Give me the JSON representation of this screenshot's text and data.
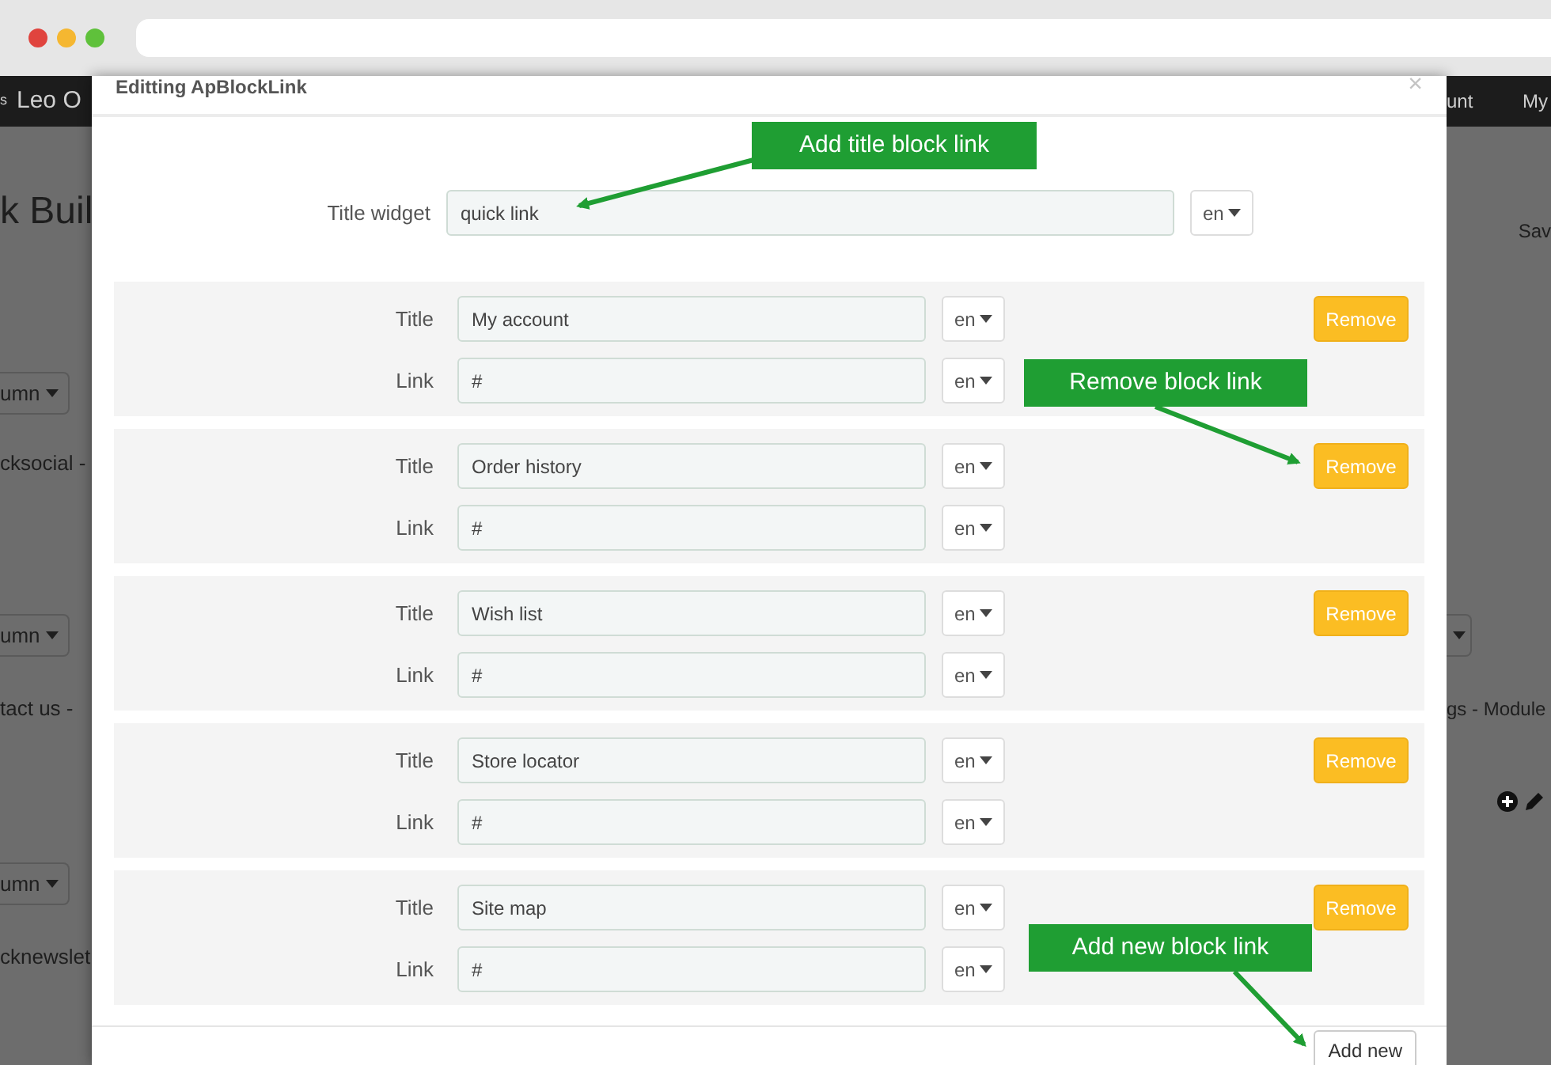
{
  "background_page": {
    "left": {
      "nav": [
        "s",
        "Leo O"
      ],
      "items": [
        {
          "kind": "heading",
          "text": "k Buil"
        },
        {
          "kind": "button",
          "text": "umn"
        },
        {
          "kind": "text",
          "text": "cksocial -"
        },
        {
          "kind": "button",
          "text": "umn"
        },
        {
          "kind": "text",
          "text": "tact us -"
        },
        {
          "kind": "button",
          "text": "umn"
        },
        {
          "kind": "text",
          "text": "cknewslet"
        }
      ]
    },
    "right": {
      "nav": [
        "unt",
        "My"
      ],
      "items": [
        {
          "kind": "text",
          "text": "Sav"
        },
        {
          "kind": "caret"
        },
        {
          "kind": "text",
          "text": "gs - Module"
        },
        {
          "kind": "icons"
        }
      ]
    }
  },
  "modal": {
    "title": "Editting ApBlockLink",
    "close": "×",
    "title_widget": {
      "label": "Title widget",
      "value": "quick link",
      "lang": "en"
    },
    "links": [
      {
        "title_label": "Title",
        "title": "My account",
        "title_lang": "en",
        "link_label": "Link",
        "link": "#",
        "link_lang": "en",
        "remove": "Remove"
      },
      {
        "title_label": "Title",
        "title": "Order history",
        "title_lang": "en",
        "link_label": "Link",
        "link": "#",
        "link_lang": "en",
        "remove": "Remove"
      },
      {
        "title_label": "Title",
        "title": "Wish list",
        "title_lang": "en",
        "link_label": "Link",
        "link": "#",
        "link_lang": "en",
        "remove": "Remove"
      },
      {
        "title_label": "Title",
        "title": "Store locator",
        "title_lang": "en",
        "link_label": "Link",
        "link": "#",
        "link_lang": "en",
        "remove": "Remove"
      },
      {
        "title_label": "Title",
        "title": "Site map",
        "title_lang": "en",
        "link_label": "Link",
        "link": "#",
        "link_lang": "en",
        "remove": "Remove"
      }
    ],
    "add_new": "Add new"
  },
  "annotations": [
    {
      "text": "Add title block link"
    },
    {
      "text": "Remove block link"
    },
    {
      "text": "Add new block link"
    }
  ]
}
